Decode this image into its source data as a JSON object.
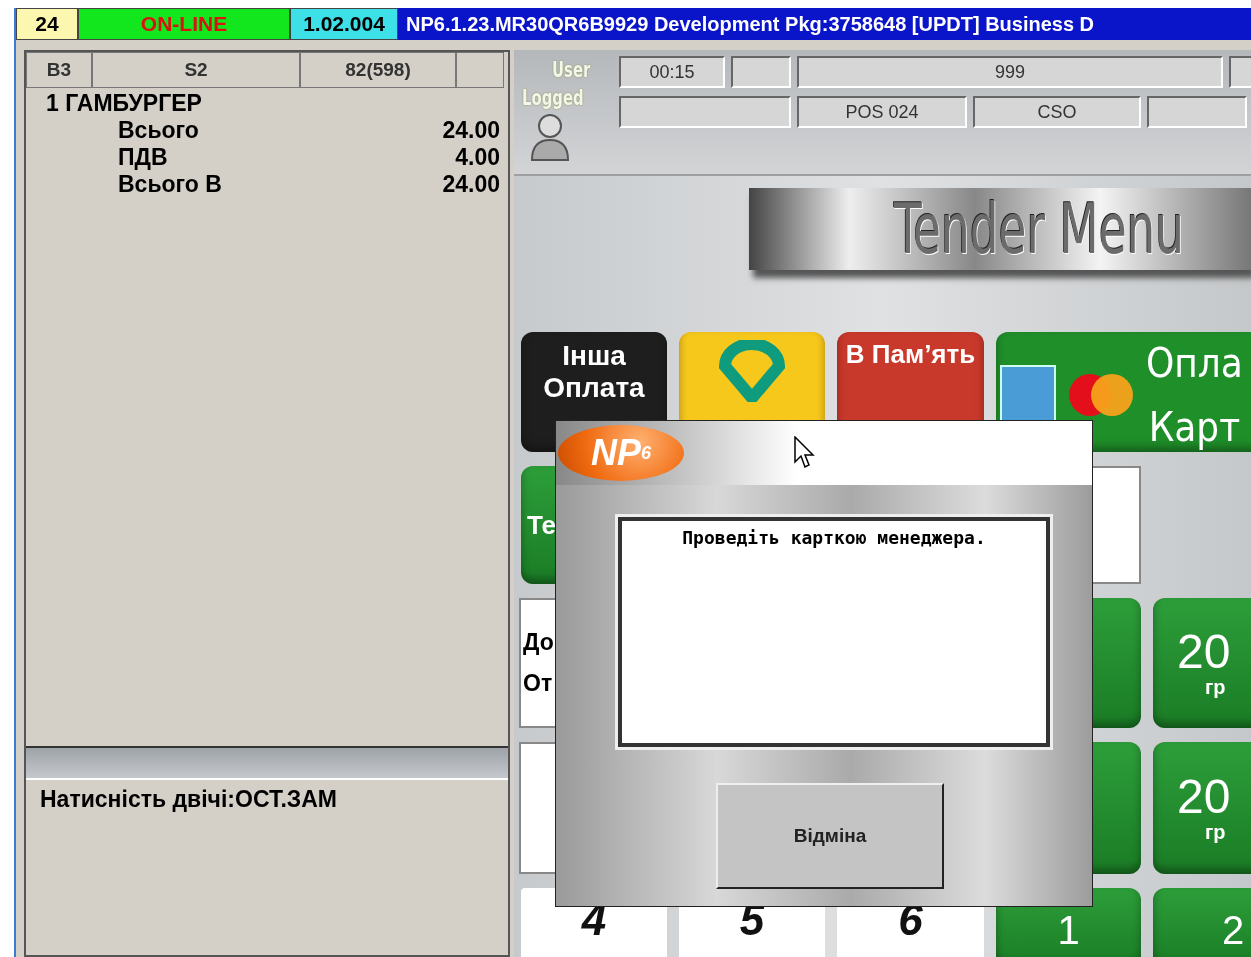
{
  "status_bar": {
    "terminal": "24",
    "connection": "ON-LINE",
    "online": true,
    "version": "1.02.004",
    "build": "NP6.1.23.MR30QR6B9929 Development Pkg:3758648  [UPDT] Business D"
  },
  "order": {
    "columns": [
      "B3",
      "S2",
      "82(598)"
    ],
    "items": [
      {
        "name": "1 ГАМБУРГЕР",
        "lines": [
          {
            "label": "Всього",
            "amount": "24.00"
          },
          {
            "label": "ПДВ",
            "amount": "4.00"
          },
          {
            "label": "Всього В",
            "amount": "24.00"
          }
        ]
      }
    ],
    "message": "Натисність двічі:ОСТ.ЗАМ"
  },
  "header": {
    "user_label": [
      "User",
      "Logged"
    ],
    "row_1": [
      {
        "kind": "value",
        "text": "00:15"
      },
      {
        "kind": "blank"
      },
      {
        "kind": "value",
        "text": "999"
      },
      {
        "kind": "blank"
      }
    ],
    "row_2": [
      {
        "kind": "blank"
      },
      {
        "kind": "value",
        "text": "POS 024"
      },
      {
        "kind": "value",
        "text": "CSO"
      },
      {
        "kind": "blank"
      }
    ]
  },
  "banner": {
    "title": "Tender Menu"
  },
  "tender_buttons": [
    {
      "kind": "text",
      "color": "#1e1e1e",
      "lines": [
        "Інша",
        "Оплата"
      ]
    },
    {
      "kind": "pin",
      "color": "#f7c81c"
    },
    {
      "kind": "text",
      "color": "#c9392b",
      "lines": [
        "В Пам’ять"
      ]
    },
    {
      "kind": "card",
      "color": "#1f8f2a",
      "lines": [
        "Опла",
        "Карт"
      ]
    }
  ],
  "partial": {
    "green_button": "Те",
    "info_lines": [
      "До",
      "От"
    ],
    "amount_buttons": [
      {
        "value": "20",
        "unit": "гр"
      },
      {
        "value": "20",
        "unit": "гр"
      }
    ],
    "keys": [
      "4",
      "5",
      "6"
    ],
    "green_keys": [
      "1",
      "2"
    ]
  },
  "dialog": {
    "logo": "NP",
    "logo_sup": "6",
    "message": "Проведіть карткою менеджера.",
    "buttons": [
      "Відміна"
    ]
  }
}
